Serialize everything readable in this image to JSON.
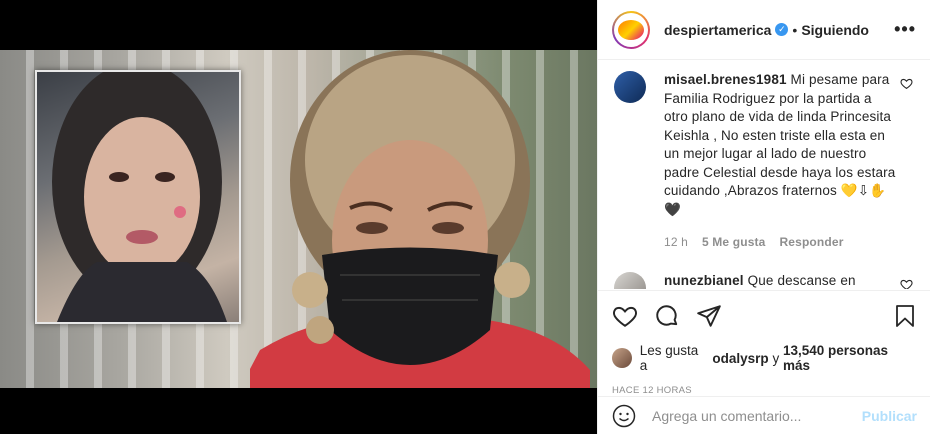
{
  "post": {
    "account": "despiertamerica",
    "separator": "•",
    "follow_state": "Siguiendo",
    "more_icon": "more-horizontal-icon",
    "more_glyph": "•••",
    "verified_glyph": "✓"
  },
  "comments": [
    {
      "user": "misael.brenes1981",
      "text": "Mi pesame para Familia Rodriguez por la partida a otro plano de vida de linda Princesita Keishla , No esten triste ella esta en un mejor lugar al lado de nuestro padre Celestial desde haya los estara cuidando ,Abrazos fraternos 💛⇩✋🖤",
      "time": "12 h",
      "likes": "5 Me gusta",
      "reply": "Responder"
    },
    {
      "user": "nunezbianel",
      "text": "Que descanse en"
    }
  ],
  "likes": {
    "prefix": "Les gusta a",
    "user": "odalysrp",
    "connector": "y",
    "others": "13,540 personas más"
  },
  "timestamp": "HACE 12 HORAS",
  "composer": {
    "placeholder": "Agrega un comentario...",
    "post_label": "Publicar"
  },
  "colors": {
    "verified": "#3897f0",
    "publish_disabled": "#b2dffc",
    "muted": "#8e8e8e"
  }
}
